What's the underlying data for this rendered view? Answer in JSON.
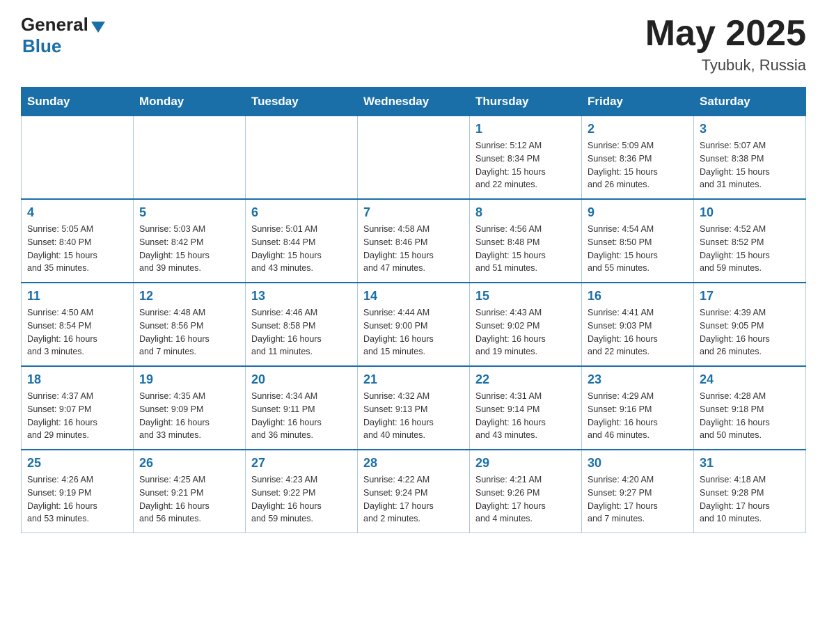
{
  "header": {
    "logo_general": "General",
    "logo_blue": "Blue",
    "title": "May 2025",
    "location": "Tyubuk, Russia"
  },
  "days_of_week": [
    "Sunday",
    "Monday",
    "Tuesday",
    "Wednesday",
    "Thursday",
    "Friday",
    "Saturday"
  ],
  "weeks": [
    [
      {
        "day": "",
        "info": ""
      },
      {
        "day": "",
        "info": ""
      },
      {
        "day": "",
        "info": ""
      },
      {
        "day": "",
        "info": ""
      },
      {
        "day": "1",
        "info": "Sunrise: 5:12 AM\nSunset: 8:34 PM\nDaylight: 15 hours\nand 22 minutes."
      },
      {
        "day": "2",
        "info": "Sunrise: 5:09 AM\nSunset: 8:36 PM\nDaylight: 15 hours\nand 26 minutes."
      },
      {
        "day": "3",
        "info": "Sunrise: 5:07 AM\nSunset: 8:38 PM\nDaylight: 15 hours\nand 31 minutes."
      }
    ],
    [
      {
        "day": "4",
        "info": "Sunrise: 5:05 AM\nSunset: 8:40 PM\nDaylight: 15 hours\nand 35 minutes."
      },
      {
        "day": "5",
        "info": "Sunrise: 5:03 AM\nSunset: 8:42 PM\nDaylight: 15 hours\nand 39 minutes."
      },
      {
        "day": "6",
        "info": "Sunrise: 5:01 AM\nSunset: 8:44 PM\nDaylight: 15 hours\nand 43 minutes."
      },
      {
        "day": "7",
        "info": "Sunrise: 4:58 AM\nSunset: 8:46 PM\nDaylight: 15 hours\nand 47 minutes."
      },
      {
        "day": "8",
        "info": "Sunrise: 4:56 AM\nSunset: 8:48 PM\nDaylight: 15 hours\nand 51 minutes."
      },
      {
        "day": "9",
        "info": "Sunrise: 4:54 AM\nSunset: 8:50 PM\nDaylight: 15 hours\nand 55 minutes."
      },
      {
        "day": "10",
        "info": "Sunrise: 4:52 AM\nSunset: 8:52 PM\nDaylight: 15 hours\nand 59 minutes."
      }
    ],
    [
      {
        "day": "11",
        "info": "Sunrise: 4:50 AM\nSunset: 8:54 PM\nDaylight: 16 hours\nand 3 minutes."
      },
      {
        "day": "12",
        "info": "Sunrise: 4:48 AM\nSunset: 8:56 PM\nDaylight: 16 hours\nand 7 minutes."
      },
      {
        "day": "13",
        "info": "Sunrise: 4:46 AM\nSunset: 8:58 PM\nDaylight: 16 hours\nand 11 minutes."
      },
      {
        "day": "14",
        "info": "Sunrise: 4:44 AM\nSunset: 9:00 PM\nDaylight: 16 hours\nand 15 minutes."
      },
      {
        "day": "15",
        "info": "Sunrise: 4:43 AM\nSunset: 9:02 PM\nDaylight: 16 hours\nand 19 minutes."
      },
      {
        "day": "16",
        "info": "Sunrise: 4:41 AM\nSunset: 9:03 PM\nDaylight: 16 hours\nand 22 minutes."
      },
      {
        "day": "17",
        "info": "Sunrise: 4:39 AM\nSunset: 9:05 PM\nDaylight: 16 hours\nand 26 minutes."
      }
    ],
    [
      {
        "day": "18",
        "info": "Sunrise: 4:37 AM\nSunset: 9:07 PM\nDaylight: 16 hours\nand 29 minutes."
      },
      {
        "day": "19",
        "info": "Sunrise: 4:35 AM\nSunset: 9:09 PM\nDaylight: 16 hours\nand 33 minutes."
      },
      {
        "day": "20",
        "info": "Sunrise: 4:34 AM\nSunset: 9:11 PM\nDaylight: 16 hours\nand 36 minutes."
      },
      {
        "day": "21",
        "info": "Sunrise: 4:32 AM\nSunset: 9:13 PM\nDaylight: 16 hours\nand 40 minutes."
      },
      {
        "day": "22",
        "info": "Sunrise: 4:31 AM\nSunset: 9:14 PM\nDaylight: 16 hours\nand 43 minutes."
      },
      {
        "day": "23",
        "info": "Sunrise: 4:29 AM\nSunset: 9:16 PM\nDaylight: 16 hours\nand 46 minutes."
      },
      {
        "day": "24",
        "info": "Sunrise: 4:28 AM\nSunset: 9:18 PM\nDaylight: 16 hours\nand 50 minutes."
      }
    ],
    [
      {
        "day": "25",
        "info": "Sunrise: 4:26 AM\nSunset: 9:19 PM\nDaylight: 16 hours\nand 53 minutes."
      },
      {
        "day": "26",
        "info": "Sunrise: 4:25 AM\nSunset: 9:21 PM\nDaylight: 16 hours\nand 56 minutes."
      },
      {
        "day": "27",
        "info": "Sunrise: 4:23 AM\nSunset: 9:22 PM\nDaylight: 16 hours\nand 59 minutes."
      },
      {
        "day": "28",
        "info": "Sunrise: 4:22 AM\nSunset: 9:24 PM\nDaylight: 17 hours\nand 2 minutes."
      },
      {
        "day": "29",
        "info": "Sunrise: 4:21 AM\nSunset: 9:26 PM\nDaylight: 17 hours\nand 4 minutes."
      },
      {
        "day": "30",
        "info": "Sunrise: 4:20 AM\nSunset: 9:27 PM\nDaylight: 17 hours\nand 7 minutes."
      },
      {
        "day": "31",
        "info": "Sunrise: 4:18 AM\nSunset: 9:28 PM\nDaylight: 17 hours\nand 10 minutes."
      }
    ]
  ]
}
